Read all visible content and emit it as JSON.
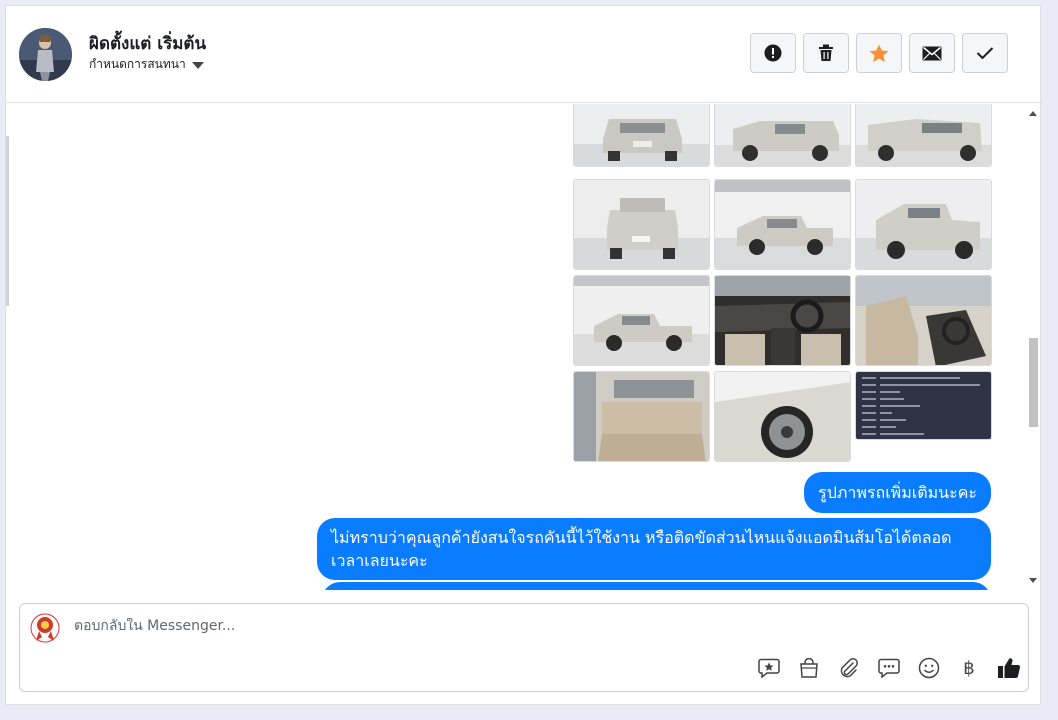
{
  "header": {
    "title": "ผิดตั้งแต่ เริ่มต้น",
    "assign_label": "กำหนดการสนทนา",
    "actions": [
      {
        "name": "report-button",
        "icon": "alert-icon"
      },
      {
        "name": "delete-button",
        "icon": "trash-icon"
      },
      {
        "name": "star-button",
        "icon": "star-icon",
        "color": "#f7923b"
      },
      {
        "name": "mail-button",
        "icon": "envelope-icon"
      },
      {
        "name": "done-button",
        "icon": "checkmark-icon"
      }
    ]
  },
  "messages": [
    {
      "text": "รูปภาพรถเพิ่มเติมนะคะ"
    },
    {
      "text": "ไม่ทราบว่าคุณลูกค้ายังสนใจรถคันนี้ไว้ใช้งาน หรือติดขัดส่วนไหนแจ้งแอดมินส้มโอได้ตลอดเวลาเลยนะคะ"
    }
  ],
  "composer": {
    "placeholder": "ตอบกลับใน Messenger...",
    "tools": [
      "saved-reply-icon",
      "shop-bag-icon",
      "attachment-icon",
      "chat-bubble-icon",
      "emoji-icon",
      "baht-icon",
      "thumbs-up-icon"
    ],
    "baht_symbol": "฿"
  },
  "colors": {
    "bubble": "#0a7cff",
    "accent_star": "#f7923b"
  }
}
